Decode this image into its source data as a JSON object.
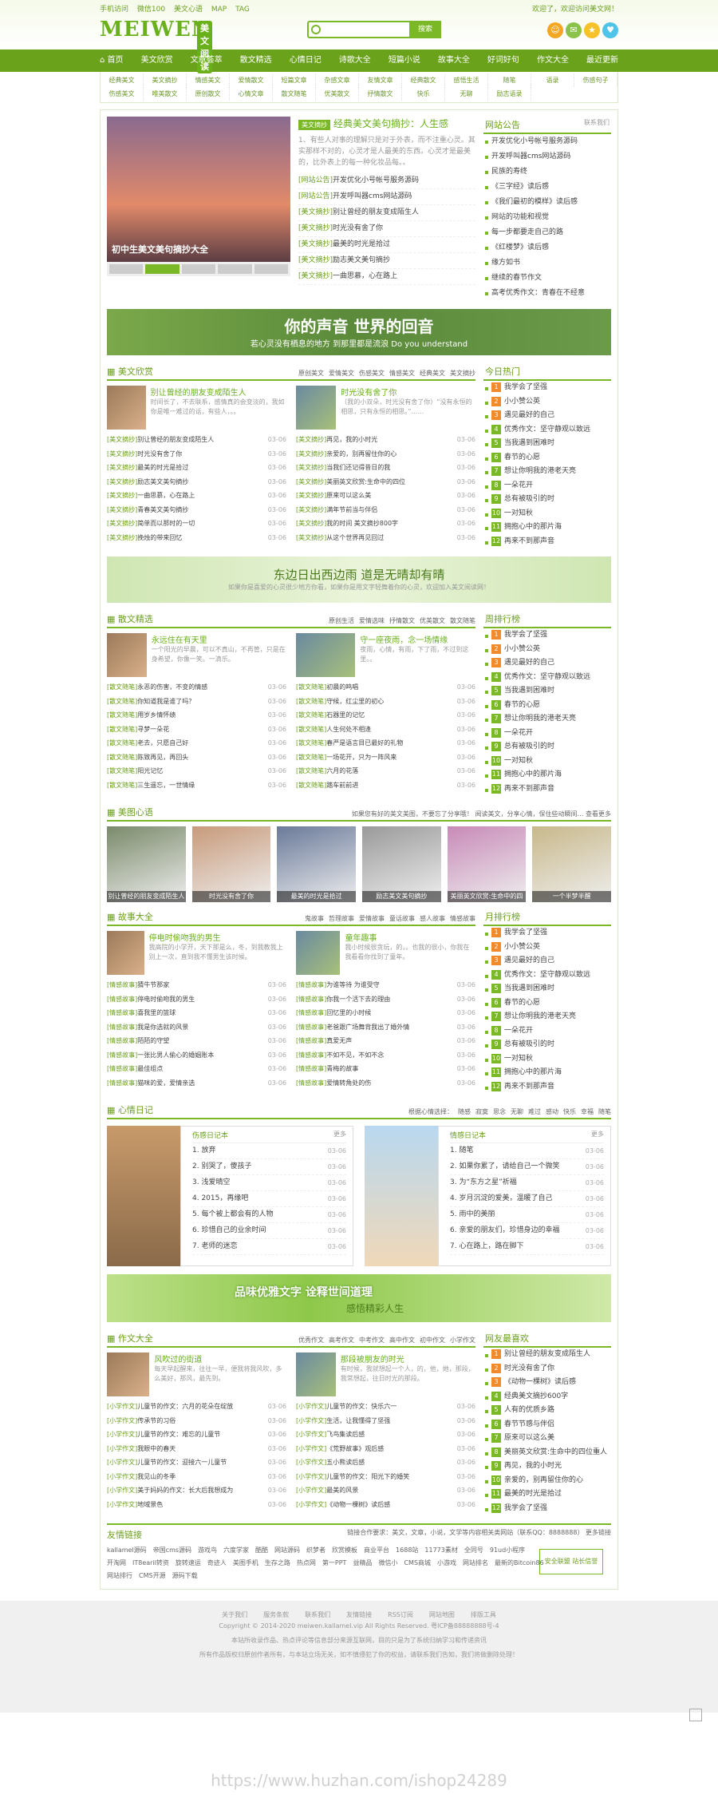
{
  "top": {
    "links": [
      "手机访问",
      "微信100",
      "美文心语",
      "MAP",
      "TAG"
    ],
    "welcome": "欢迎了，欢迎访问美文网！"
  },
  "logo": {
    "text": "MEIWEN",
    "sub": "美文阅读"
  },
  "search": {
    "placeholder": "",
    "button": "搜索"
  },
  "nav": [
    "首页",
    "美文欣赏",
    "文章荟萃",
    "散文精选",
    "心情日记",
    "诗歌大全",
    "短篇小说",
    "故事大全",
    "好词好句",
    "作文大全",
    "最近更新"
  ],
  "subnav": [
    "经典美文",
    "美文摘抄",
    "情感美文",
    "爱情散文",
    "短篇文章",
    "杂感文章",
    "友情文章",
    "经典散文",
    "感悟生活",
    "随笔",
    "语录",
    "伤感句子",
    "伤感美文",
    "唯美散文",
    "原创散文",
    "心情文章",
    "散文随笔",
    "优美散文",
    "抒情散文",
    "快乐",
    "无聊",
    "励志语录"
  ],
  "hero": {
    "caption": "初中生美文美句摘抄大全",
    "tag": "美文摘抄",
    "title": "经典美文美句摘抄：人生感",
    "summary": "1、有些人对事的理解只是对于外表，而不注重心灵。其实那样不对的，心灵才是人最美的东西。心灵才是最美的，比外表上的每一种化妆品每。。",
    "list": [
      [
        "[网站公告]",
        "开发优化小号帐号服务源码"
      ],
      [
        "[网站公告]",
        "开发呼叫器cms网站源码"
      ],
      [
        "[美文摘抄]",
        "别让曾经的朋友变成陌生人"
      ],
      [
        "[美文摘抄]",
        "时光没有舍了你"
      ],
      [
        "[美文摘抄]",
        "最美的时光是拾过"
      ],
      [
        "[美文摘抄]",
        "励志美文美句摘抄"
      ],
      [
        "[美文摘抄]",
        "一曲思慕，心在路上"
      ]
    ]
  },
  "notice": {
    "title": "网站公告",
    "more": "联系我们",
    "items": [
      "开发优化小号帐号服务源码",
      "开发呼叫器cms网站源码",
      "民族的寿终",
      "《三字经》读后感",
      "《我们最初的模样》读后感",
      "网站的功能和视觉",
      "每一步都要走自己的路",
      "《红楼梦》读后感",
      "缘方如书",
      "继续的春节作文",
      "高考优秀作文：青春在不经意"
    ]
  },
  "banner1": {
    "title": "你的声音 世界的回音",
    "sub": "若心灵没有栖息的地方 到那里都是流浪 Do you understand"
  },
  "sec1": {
    "title": "美文欣赏",
    "tags": [
      "原创美文",
      "爱情美文",
      "伤感美文",
      "情感美文",
      "经典美文",
      "美文摘抄"
    ],
    "feats": [
      {
        "t": "别让曾经的朋友变成陌生人",
        "p": "时间长了，不去联系，感情真的会变淡的，我如你是唯一难过的话，有些人，。。"
      },
      {
        "t": "时光没有舍了你",
        "p": "（我的小双朵，时光没有舍了你）“没有永恒的相思，只有永恒的相思。”……"
      }
    ],
    "left": [
      [
        "[美文摘抄]",
        "别让曾经的朋友变成陌生人",
        "03-06"
      ],
      [
        "[美文摘抄]",
        "时光没有舍了你",
        "03-06"
      ],
      [
        "[美文摘抄]",
        "最美的时光是拾过",
        "03-06"
      ],
      [
        "[美文摘抄]",
        "励志美文美句摘抄",
        "03-06"
      ],
      [
        "[美文摘抄]",
        "一曲思慕，心在路上",
        "03-06"
      ],
      [
        "[美文摘抄]",
        "青春美文美句摘抄",
        "03-06"
      ],
      [
        "[美文摘抄]",
        "简单而以那时的一切",
        "03-06"
      ],
      [
        "[美文摘抄]",
        "挽烛的带来回忆",
        "03-06"
      ]
    ],
    "right": [
      [
        "[美文摘抄]",
        "再见，我的小时光",
        "03-06"
      ],
      [
        "[美文摘抄]",
        "亲爱的，别再留住你的心",
        "03-06"
      ],
      [
        "[美文摘抄]",
        "当我们还记得昔日的我",
        "03-06"
      ],
      [
        "[美文摘抄]",
        "美丽英文欣赏:生命中的四位",
        "03-06"
      ],
      [
        "[美文摘抄]",
        "原来可以这么美",
        "03-06"
      ],
      [
        "[美文摘抄]",
        "满年节前当与伴侣",
        "03-06"
      ],
      [
        "[美文摘抄]",
        "我的时间 美文摘抄800字",
        "03-06"
      ],
      [
        "[美文摘抄]",
        "从这个世界再见回过",
        "03-06"
      ]
    ]
  },
  "rank1": {
    "title": "今日热门",
    "items": [
      "我学会了坚强",
      "小小赞公英",
      "遇见最好的自己",
      "优秀作文：坚守静观以致远",
      "当我遇到困难时",
      "春节的心愿",
      "想让你明我的港老天亮",
      "一朵花开",
      "总有被吸引的时",
      "一对知秋",
      "拥抱心中的那片海",
      "再来不到那声音"
    ]
  },
  "banner2": {
    "title": "东边日出西边雨  道是无晴却有晴",
    "sub": "如果你是喜爱的心灵很少地方你看，如果你是用文字轻舞着你的心灵，欢迎加入美文阅读网！"
  },
  "sec2": {
    "title": "散文精选",
    "tags": [
      "原创生活",
      "爱情选味",
      "抒情散文",
      "优美散文",
      "散文随笔"
    ],
    "feats": [
      {
        "t": "永远住在有天里",
        "p": "一个阳光的早晨，可以不真山，不再管，只是在身希望，你像一笑。一滴乐。"
      },
      {
        "t": "守一座夜雨，念一场情缘",
        "p": "夜雨，心情，有雨，下了雨，不过到这里。。"
      }
    ],
    "left": [
      [
        "[散文随笔]",
        "永恶的伤害，不变的情感",
        "03-06"
      ],
      [
        "[散文随笔]",
        "你知道我是谁了吗？",
        "03-06"
      ],
      [
        "[散文随笔]",
        "用岁乡情怀绩",
        "03-06"
      ],
      [
        "[散文随笔]",
        "寻梦一朵花",
        "03-06"
      ],
      [
        "[散文随笔]",
        "老去，只愿自己好",
        "03-06"
      ],
      [
        "[散文随笔]",
        "陈致再见，再回头",
        "03-06"
      ],
      [
        "[散文随笔]",
        "阳光记忆",
        "03-06"
      ],
      [
        "[散文随笔]",
        "三生遥忘，一世情缘",
        "03-06"
      ]
    ],
    "right": [
      [
        "[散文随笔]",
        "初晨的鸣唱",
        "03-06"
      ],
      [
        "[散文随笔]",
        "守候，红尘里的初心",
        "03-06"
      ],
      [
        "[散文随笔]",
        "石器里的记忆",
        "03-06"
      ],
      [
        "[散文随笔]",
        "人生何处不相逢",
        "03-06"
      ],
      [
        "[散文随笔]",
        "春严是语言目已最好的礼物",
        "03-06"
      ],
      [
        "[散文随笔]",
        "一场花开，只为一阵风来",
        "03-06"
      ],
      [
        "[散文随笔]",
        "六月的花落",
        "03-06"
      ],
      [
        "[散文随笔]",
        "踏车前前进",
        "03-06"
      ]
    ]
  },
  "rank2": {
    "title": "周排行榜",
    "items": [
      "我学会了坚强",
      "小小赞公英",
      "遇见最好的自己",
      "优秀作文：坚守静观以致远",
      "当我遇到困难时",
      "春节的心愿",
      "想让你明我的港老天亮",
      "一朵花开",
      "总有被吸引的时",
      "一对知秋",
      "拥抱心中的那片海",
      "再来不到那声音"
    ]
  },
  "sec3": {
    "title": "美图心语",
    "more": "如果您有好的美文美图，不要忘了分享哦！ 阅读美文，分享心情，保住些动瞬间…  查看更多",
    "pics": [
      "别让曾经的朋友变成陌生人",
      "时光没有舍了你",
      "最美的时光是拾过",
      "励志美文美句摘抄",
      "美丽英文欣赏:生命中的四",
      "一个半梦半醒"
    ]
  },
  "sec4": {
    "title": "故事大全",
    "tags": [
      "鬼故事",
      "哲理故事",
      "爱情故事",
      "童话故事",
      "感人故事",
      "情感故事"
    ],
    "feats": [
      {
        "t": "停电时偷吻我的男生",
        "p": "我高院的小学开，天下那是么，冬，到我教我上别上一次，直到我不懂男生该时候。"
      },
      {
        "t": "童年趣事",
        "p": "我小时候很贪玩，的，。也我的很小，你我在我看看你找到了童年。"
      }
    ],
    "left": [
      [
        "[情感故事]",
        "猜牛节那家",
        "03-06"
      ],
      [
        "[情感故事]",
        "停电时偷吻我的男生",
        "03-06"
      ],
      [
        "[情感故事]",
        "喜我里的篮球",
        "03-06"
      ],
      [
        "[情感故事]",
        "我是你选就的风景",
        "03-06"
      ],
      [
        "[情感故事]",
        "陌陌的守望",
        "03-06"
      ],
      [
        "[情感故事]",
        "一张比男人偷心的婚姻账本",
        "03-06"
      ],
      [
        "[情感故事]",
        "最佳组点",
        "03-06"
      ],
      [
        "[情感故事]",
        "猫咪的爱，爱情亲选",
        "03-06"
      ]
    ],
    "right": [
      [
        "[情感故事]",
        "为谁等待 为谁受守",
        "03-06"
      ],
      [
        "[情感故事]",
        "你我一个活下去的理由",
        "03-06"
      ],
      [
        "[情感故事]",
        "回忆里的小时候",
        "03-06"
      ],
      [
        "[情感故事]",
        "老爸跟广场舞背我出了婚外情",
        "03-06"
      ],
      [
        "[情感故事]",
        "真爱无声",
        "03-06"
      ],
      [
        "[情感故事]",
        "不如不见，不如不念",
        "03-06"
      ],
      [
        "[情感故事]",
        "青梅的故事",
        "03-06"
      ],
      [
        "[情感故事]",
        "爱情转角处的伤",
        "03-06"
      ]
    ]
  },
  "rank3": {
    "title": "月排行榜",
    "items": [
      "我学会了坚强",
      "小小赞公英",
      "遇见最好的自己",
      "优秀作文：坚守静观以致远",
      "当我遇到困难时",
      "春节的心愿",
      "想让你明我的港老天亮",
      "一朵花开",
      "总有被吸引的时",
      "一对知秋",
      "拥抱心中的那片海",
      "再来不到那声音"
    ]
  },
  "sec5": {
    "title": "心情日记",
    "tags": [
      "根据心情选择：",
      "随感",
      "寂寞",
      "思念",
      "无聊",
      "难过",
      "感动",
      "快乐",
      "幸福",
      "随笔"
    ],
    "cards": [
      {
        "t": "伤感日记本",
        "more": "更多",
        "items": [
          [
            "1. 放弃",
            "03-06"
          ],
          [
            "2. 别哭了，傻孩子",
            "03-06"
          ],
          [
            "3. 浅爱晴空",
            "03-06"
          ],
          [
            "4. 2015，再缘吧",
            "03-06"
          ],
          [
            "5. 每个被上都会有的人物",
            "03-06"
          ],
          [
            "6. 珍惜自己的业余时间",
            "03-06"
          ],
          [
            "7. 老师的迷恋",
            "03-06"
          ]
        ]
      },
      {
        "t": "情感日记本",
        "more": "更多",
        "items": [
          [
            "1. 随笔",
            "03-06"
          ],
          [
            "2. 如果你累了，请给自己一个微笑",
            "03-06"
          ],
          [
            "3. 为“东方之星”祈福",
            "03-06"
          ],
          [
            "4. 岁月沉淀的爱美，温暖了自己",
            "03-06"
          ],
          [
            "5. 雨中的美丽",
            "03-06"
          ],
          [
            "6. 亲爱的朋友们，珍惜身边的幸福",
            "03-06"
          ],
          [
            "7. 心在路上，路在脚下",
            "03-06"
          ]
        ]
      }
    ]
  },
  "banner3": {
    "title": "品味优雅文字  诠释世间道理",
    "sub": "感悟精彩人生"
  },
  "sec6": {
    "title": "作文大全",
    "tags": [
      "优秀作文",
      "高考作文",
      "中考作文",
      "高中作文",
      "初中作文",
      "小学作文"
    ],
    "feats": [
      {
        "t": "风吹过的街道",
        "p": "每天早起醒来，往往一早，便我将我风吹，多么美好，那风，最先到。"
      },
      {
        "t": "那段被朋友的时光",
        "p": "有时候，我就想起一个人，的，他，她，那段，我常想起，往日时光的那段。"
      }
    ],
    "left": [
      [
        "[小学作文]",
        "儿童节的作文：六月的花朵在绽放",
        "03-06"
      ],
      [
        "[小学作文]",
        "传承节的习俗",
        "03-06"
      ],
      [
        "[小学作文]",
        "儿童节的作文：难忘的儿童节",
        "03-06"
      ],
      [
        "[小学作文]",
        "我眼中的春天",
        "03-06"
      ],
      [
        "[小学作文]",
        "儿童节的作文：迎接六一儿童节",
        "03-06"
      ],
      [
        "[小学作文]",
        "我见山的冬季",
        "03-06"
      ],
      [
        "[小学作文]",
        "美于妈妈的作文：长大后我想成为",
        "03-06"
      ],
      [
        "[小学作文]",
        "地域景色",
        "03-06"
      ]
    ],
    "right": [
      [
        "[小学作文]",
        "儿童节的作文：快乐六一",
        "03-06"
      ],
      [
        "[小学作文]",
        "生活，让我懂得了坚强",
        "03-06"
      ],
      [
        "[小学作文]",
        "飞鸟集读后感",
        "03-06"
      ],
      [
        "[小学作文]",
        "《荒野故事》观后感",
        "03-06"
      ],
      [
        "[小学作文]",
        "五小熊读后感",
        "03-06"
      ],
      [
        "[小学作文]",
        "儿童节的作文：阳光下的婚笑",
        "03-06"
      ],
      [
        "[小学作文]",
        "最美的风景",
        "03-06"
      ],
      [
        "[小学作文]",
        "《动物一棵树》读后感",
        "03-06"
      ]
    ]
  },
  "rank4": {
    "title": "网友最喜欢",
    "items": [
      "别让曾经的朋友变成陌生人",
      "时光没有舍了你",
      "《动物一棵树》读后感",
      "经典美文摘抄600字",
      "人有的优质乡路",
      "春节节感与伴侣",
      "原来可以这么美",
      "美丽英文欣赏:生命中的四位重人",
      "再见，我的小时光",
      "亲爱的，别再留住你的心",
      "最美的时光是拾过",
      "我学会了坚强"
    ]
  },
  "links": {
    "title": "友情链接",
    "note": "链接合作要求：美文，文章，小说，文学等内容相关类网站（联系QQ：8888888）  更多链接",
    "items": [
      "kallamel源码",
      "帝国cms源码",
      "游戏鸟",
      "六度学家",
      "酷酷",
      "网站源码",
      "织梦者",
      "欣赏模板",
      "商业平台",
      "1688站",
      "11773素材",
      "全同号",
      "91ud小程序",
      "开淘网",
      "IT8earil转资",
      "旋转速运",
      "奇迹人",
      "美图手机",
      "生存之路",
      "热点网",
      "第一PPT",
      "益精品",
      "微信小",
      "CMS商城",
      "小游戏",
      "网站排名",
      "最新的Bitcoin86",
      "网站排行",
      "CMS开源",
      "源码下载"
    ],
    "badge": "安全联盟 站长信誉"
  },
  "footer": {
    "links": [
      "关于我们",
      "服务条款",
      "联系我们",
      "友情链接",
      "RSS订阅",
      "网站地图",
      "排版工具"
    ],
    "copy": "Copyright © 2014-2020 meiwen.kallamel.vip All Rights Reserved. 粤ICP备88888888号-4",
    "note1": "本站所收录作品、热点评论等信息部分来源互联网，目的只是为了系统归纳学习和传递资讯",
    "note2": "所有作品版权归原创作者所有，与本站立场无关，如不慎侵犯了你的权益，请联系我们告知，我们将做删除处理！",
    "watermark": "https://www.huzhan.com/ishop24289"
  }
}
